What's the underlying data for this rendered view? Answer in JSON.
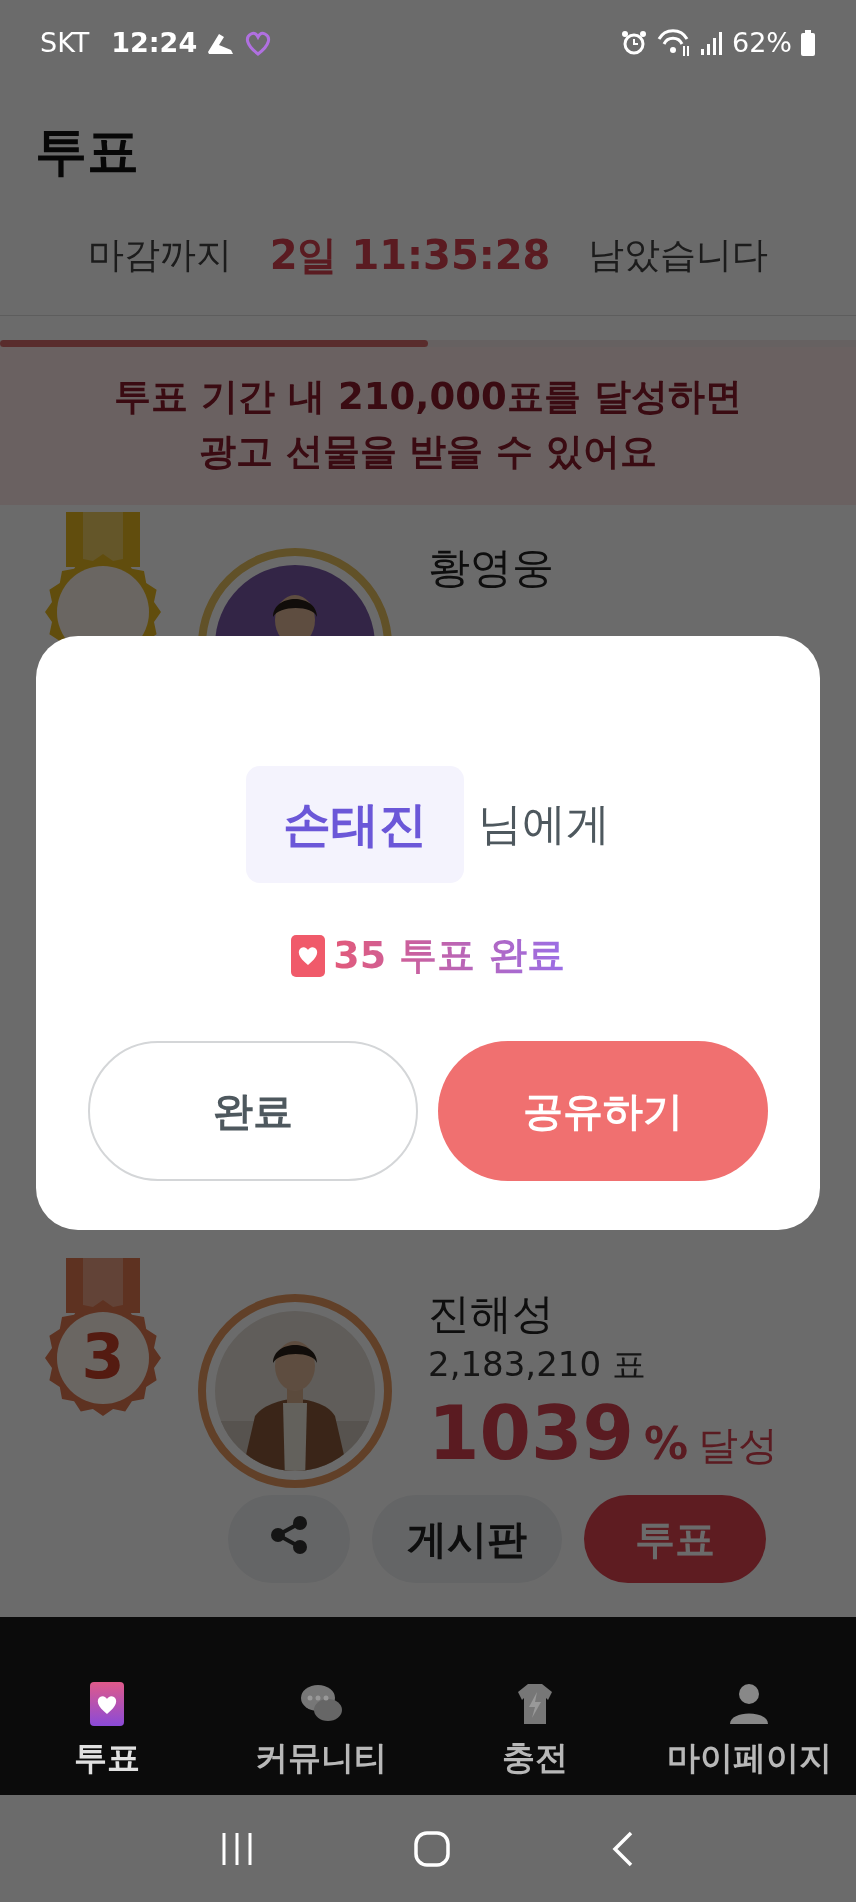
{
  "status_bar": {
    "carrier": "SKT",
    "time": "12:24",
    "battery": "62%"
  },
  "header": {
    "title": "투표"
  },
  "countdown": {
    "prefix": "마감까지",
    "remaining": "2일 11:35:28",
    "suffix": "남았습니다"
  },
  "goal": {
    "level": 0.5,
    "message_lines": [
      "투표 기간 내 210,000표를 달성하면",
      "광고 선물을 받을 수 있어요"
    ]
  },
  "candidates": [
    {
      "name": "황영웅",
      "kind": "gold"
    },
    {
      "rank": "3",
      "name": "진해성",
      "kind": "bronze",
      "votes": "2,183,210 표",
      "percent": "1039",
      "percent_unit": "%",
      "percent_label": "달성",
      "actions": [
        {
          "kind": "share"
        },
        {
          "kind": "board",
          "label": "게시판"
        },
        {
          "kind": "vote",
          "label": "투표"
        }
      ]
    }
  ],
  "modal": {
    "recipient": "손태진",
    "recipient_suffix": "님에게",
    "result": "35 투표 완료",
    "buttons": [
      {
        "label": "완료",
        "kind": "secondary"
      },
      {
        "label": "공유하기",
        "kind": "primary"
      }
    ]
  },
  "bottom_nav": [
    {
      "label": "투표",
      "selected": true
    },
    {
      "label": "커뮤니티",
      "selected": false
    },
    {
      "label": "충전",
      "selected": false
    },
    {
      "label": "마이페이지",
      "selected": false
    }
  ]
}
